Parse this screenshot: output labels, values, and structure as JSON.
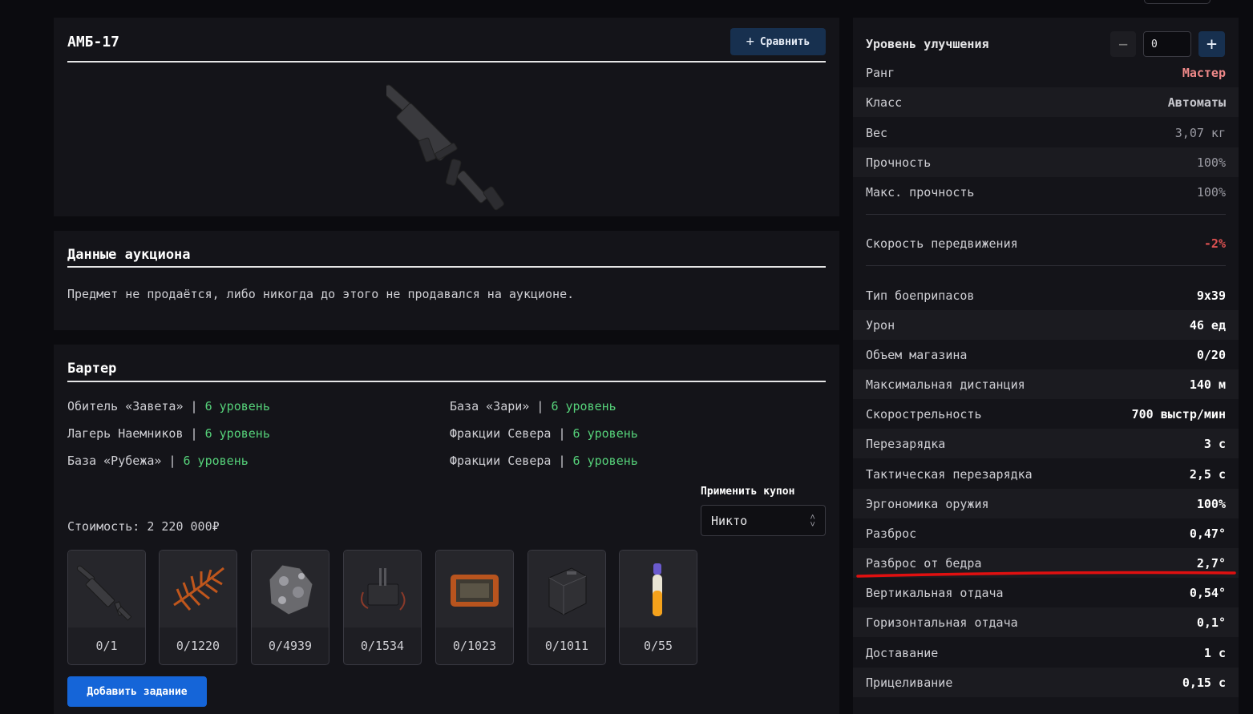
{
  "item": {
    "title": "АМБ-17",
    "compare_label": "Сравнить",
    "compare_icon": "plus-icon"
  },
  "auction": {
    "title": "Данные аукциона",
    "text": "Предмет не продаётся, либо никогда до этого не продавался на аукционе."
  },
  "barter": {
    "title": "Бартер",
    "locations": [
      {
        "name": "Обитель «Завета»",
        "sep": "|",
        "level": "6 уровень"
      },
      {
        "name": "Лагерь Наемников",
        "sep": "|",
        "level": "6 уровень"
      },
      {
        "name": "База «Рубежа»",
        "sep": "|",
        "level": "6 уровень"
      },
      {
        "name": "База «Зари»",
        "sep": "|",
        "level": "6 уровень"
      },
      {
        "name": "Фракции Севера",
        "sep": "|",
        "level": "6 уровень"
      },
      {
        "name": "Фракции Севера",
        "sep": "|",
        "level": "6 уровень"
      }
    ],
    "coupon_label": "Применить купон",
    "coupon_value": "Никто",
    "cost": "Стоимость: 2 220 000₽",
    "items": [
      {
        "count": "0/1",
        "icon": "smg-icon"
      },
      {
        "count": "0/1220",
        "icon": "fern-icon"
      },
      {
        "count": "0/4939",
        "icon": "ore-icon"
      },
      {
        "count": "0/1534",
        "icon": "device-icon"
      },
      {
        "count": "0/1023",
        "icon": "tablet-icon"
      },
      {
        "count": "0/1011",
        "icon": "ammo-box-icon"
      },
      {
        "count": "0/55",
        "icon": "vial-icon"
      }
    ],
    "add_task_label": "Добавить задание"
  },
  "stats": {
    "upgrade_label": "Уровень улучшения",
    "upgrade_value": "0",
    "minus": "−",
    "plus": "+",
    "rows": [
      {
        "label": "Ранг",
        "value": "Мастер"
      },
      {
        "label": "Класс",
        "value": "Автоматы"
      },
      {
        "label": "Вес",
        "value": "3,07 кг"
      },
      {
        "label": "Прочность",
        "value": "100%"
      },
      {
        "label": "Макс. прочность",
        "value": "100%"
      },
      {
        "label": "Скорость передвижения",
        "value": "-2%"
      },
      {
        "label": "Тип боеприпасов",
        "value": "9x39"
      },
      {
        "label": "Урон",
        "value": "46 ед"
      },
      {
        "label": "Объем магазина",
        "value": "0/20"
      },
      {
        "label": "Максимальная дистанция",
        "value": "140 м"
      },
      {
        "label": "Скорострельность",
        "value": "700 выстр/мин"
      },
      {
        "label": "Перезарядка",
        "value": "3 с"
      },
      {
        "label": "Тактическая перезарядка",
        "value": "2,5 с"
      },
      {
        "label": "Эргономика оружия",
        "value": "100%"
      },
      {
        "label": "Разброс",
        "value": "0,47°"
      },
      {
        "label": "Разброс от бедра",
        "value": "2,7°"
      },
      {
        "label": "Вертикальная отдача",
        "value": "0,54°"
      },
      {
        "label": "Горизонтальная отдача",
        "value": "0,1°"
      },
      {
        "label": "Доставание",
        "value": "1 с"
      },
      {
        "label": "Прицеливание",
        "value": "0,15 с"
      }
    ]
  },
  "colors": {
    "background": "#0b0b0f",
    "panel": "#141419",
    "level_green": "#56d27a",
    "rank_pink": "#f08989",
    "negative_red": "#e05252",
    "primary_blue": "#1565d8",
    "annotation_red": "#e01010"
  }
}
